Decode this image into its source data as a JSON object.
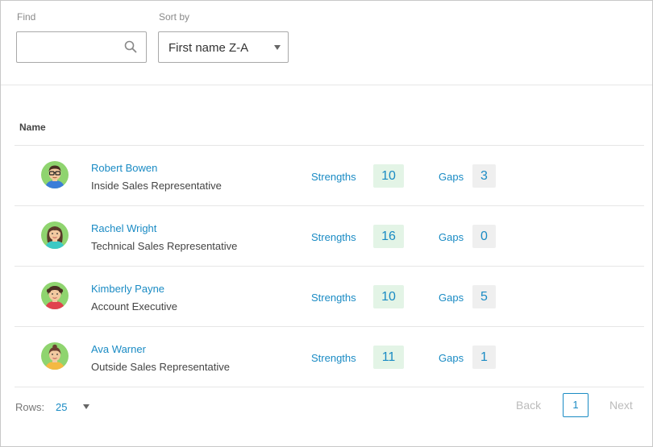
{
  "filters": {
    "find_label": "Find",
    "find_value": "",
    "find_placeholder": "",
    "sort_label": "Sort by",
    "sort_value": "First name Z-A"
  },
  "table": {
    "name_header": "Name",
    "strengths_label": "Strengths",
    "gaps_label": "Gaps",
    "rows": [
      {
        "name": "Robert Bowen",
        "title": "Inside Sales Representative",
        "strengths": "10",
        "gaps": "3"
      },
      {
        "name": "Rachel Wright",
        "title": "Technical Sales Representative",
        "strengths": "16",
        "gaps": "0"
      },
      {
        "name": "Kimberly Payne",
        "title": "Account Executive",
        "strengths": "10",
        "gaps": "5"
      },
      {
        "name": "Ava Warner",
        "title": "Outside Sales Representative",
        "strengths": "11",
        "gaps": "1"
      }
    ]
  },
  "pagination": {
    "rows_label": "Rows:",
    "rows_value": "25",
    "back_label": "Back",
    "current_page": "1",
    "next_label": "Next"
  },
  "colors": {
    "link": "#1a8bc4",
    "strength_badge_bg": "#e3f4e6",
    "gap_badge_bg": "#efefef",
    "avatar_bg": "#8fd46f"
  },
  "icons": {
    "search": "search-icon",
    "avatars": [
      "avatar-man-glasses-icon",
      "avatar-woman-icon",
      "avatar-woman-curly-icon",
      "avatar-woman-icon"
    ]
  }
}
